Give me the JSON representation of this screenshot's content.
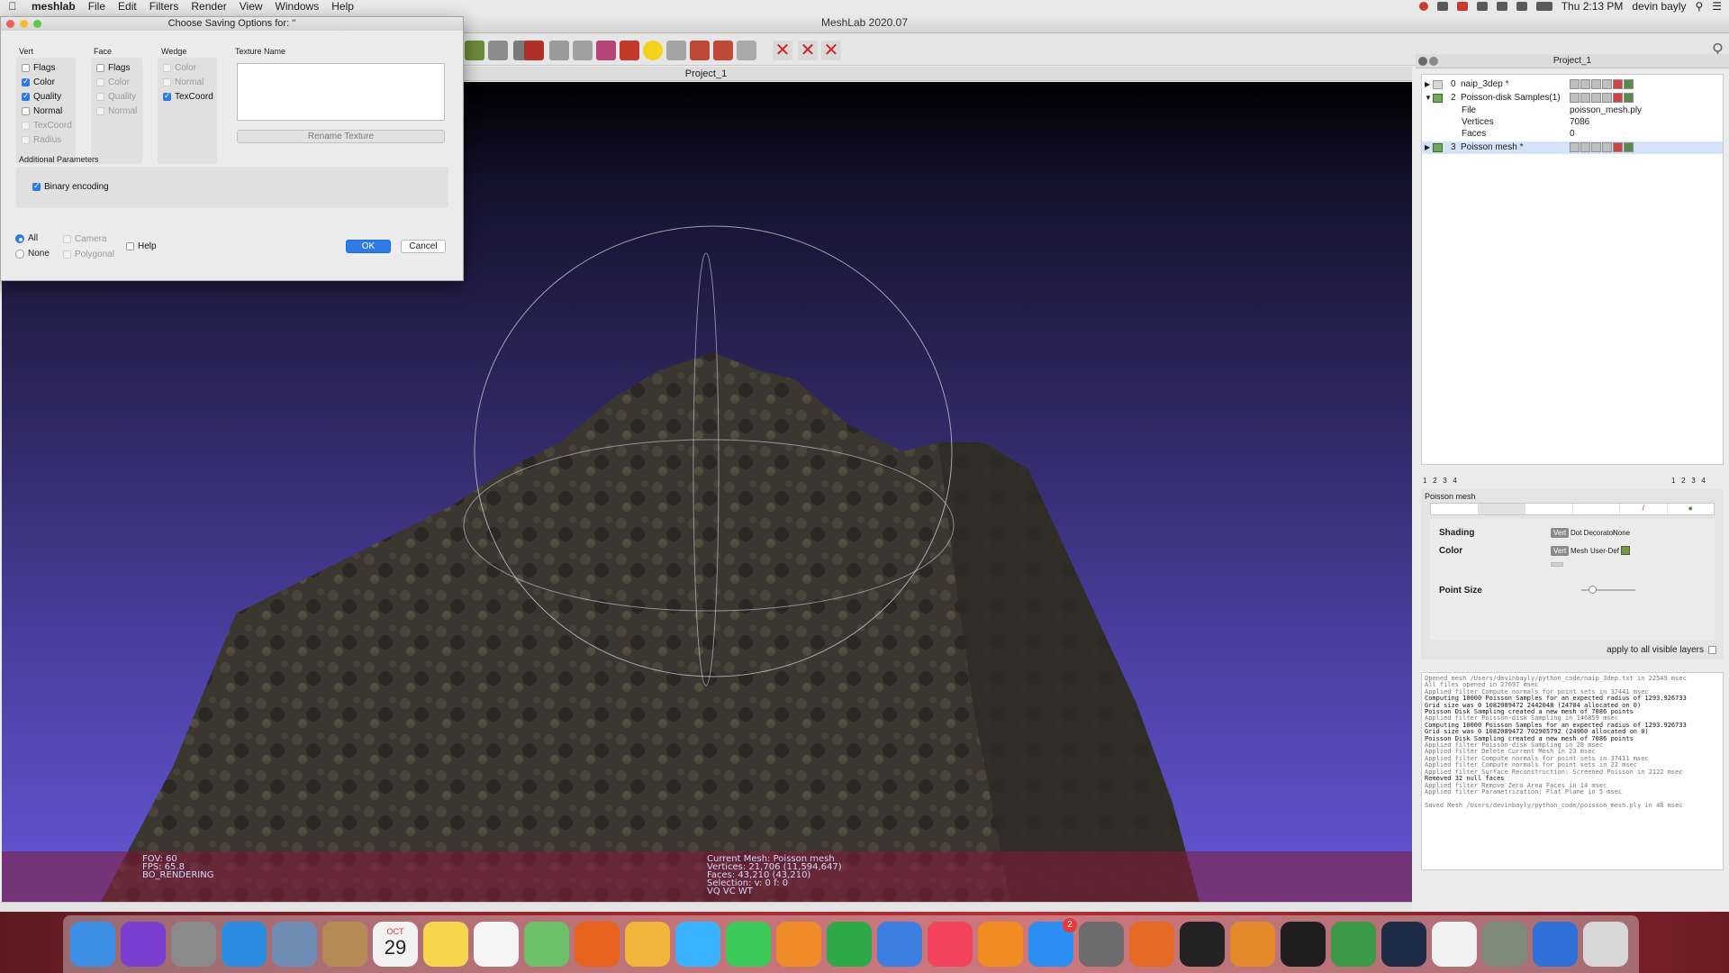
{
  "menubar": {
    "app_name": "meshlab",
    "menus": [
      "File",
      "Edit",
      "Filters",
      "Render",
      "View",
      "Windows",
      "Help"
    ],
    "clock": "Thu 2:13 PM",
    "user": "devin bayly"
  },
  "window": {
    "title": "MeshLab 2020.07",
    "viewport_tab": "Project_1"
  },
  "dialog": {
    "title": "Choose Saving Options for: ''",
    "groups": {
      "vert": {
        "label": "Vert",
        "items": [
          {
            "label": "Flags",
            "checked": false,
            "enabled": true
          },
          {
            "label": "Color",
            "checked": true,
            "enabled": true
          },
          {
            "label": "Quality",
            "checked": true,
            "enabled": true
          },
          {
            "label": "Normal",
            "checked": false,
            "enabled": true
          },
          {
            "label": "TexCoord",
            "checked": false,
            "enabled": false
          },
          {
            "label": "Radius",
            "checked": false,
            "enabled": false
          }
        ]
      },
      "face": {
        "label": "Face",
        "items": [
          {
            "label": "Flags",
            "checked": false,
            "enabled": true
          },
          {
            "label": "Color",
            "checked": false,
            "enabled": false
          },
          {
            "label": "Quality",
            "checked": false,
            "enabled": false
          },
          {
            "label": "Normal",
            "checked": false,
            "enabled": false
          }
        ]
      },
      "wedge": {
        "label": "Wedge",
        "items": [
          {
            "label": "Color",
            "checked": false,
            "enabled": false
          },
          {
            "label": "Normal",
            "checked": false,
            "enabled": false
          },
          {
            "label": "TexCoord",
            "checked": true,
            "enabled": true
          }
        ]
      }
    },
    "texture_name_label": "Texture Name",
    "rename_texture_label": "Rename Texture",
    "additional_params_label": "Additional Parameters",
    "binary_encoding_label": "Binary encoding",
    "binary_encoding_checked": true,
    "all_label": "All",
    "none_label": "None",
    "camera_label": "Camera",
    "polygonal_label": "Polygonal",
    "help_label": "Help",
    "ok_label": "OK",
    "cancel_label": "Cancel"
  },
  "hud": {
    "left": [
      "FOV: 60",
      "FPS:   65.8",
      "BO_RENDERING"
    ],
    "center": [
      "Current Mesh: Poisson mesh",
      "Vertices: 21,706    (11,594,647)",
      "Faces: 43,210    (43,210)",
      "Selection: v: 0 f: 0",
      "VQ VC WT"
    ]
  },
  "layers": {
    "header": "Project_1",
    "rows": [
      {
        "num": "0",
        "name": "naip_3dep *",
        "expanded": false,
        "selected": false
      },
      {
        "num": "2",
        "name": "Poisson-disk Samples(1)",
        "expanded": true,
        "selected": false
      },
      {
        "num": "3",
        "name": "Poisson mesh *",
        "expanded": false,
        "selected": true
      }
    ],
    "details": [
      {
        "key": "File",
        "value": "poisson_mesh.ply"
      },
      {
        "key": "Vertices",
        "value": "7086"
      },
      {
        "key": "Faces",
        "value": "0"
      }
    ],
    "pager_left": [
      "1",
      "2",
      "3",
      "4"
    ],
    "pager_right": [
      "1",
      "2",
      "3",
      "4"
    ]
  },
  "props": {
    "title": "Poisson mesh",
    "shading_label": "Shading",
    "shading_options": [
      "Vert",
      "Dot Decorator",
      "None"
    ],
    "color_label": "Color",
    "color_options": [
      "Vert",
      "Mesh",
      "User-Def"
    ],
    "point_size_label": "Point Size",
    "apply_all_label": "apply to all visible layers",
    "user_color": "#6a9a3a",
    "point_size_level": 0.15
  },
  "log": [
    {
      "t": "Opened mesh /Users/devinbayly/python_code/naip_3dep.txt in 22549 msec",
      "b": false
    },
    {
      "t": "All files opened in 27697 msec",
      "b": false
    },
    {
      "t": "Applied filter Compute normals for point sets in 37441 msec",
      "b": false
    },
    {
      "t": "Computing 10000 Poisson Samples for an expected radius of 1293.926733",
      "b": true
    },
    {
      "t": "Grid size was 0 1082089472 2442048 (24704 allocated on 0)",
      "b": true
    },
    {
      "t": "Poisson Disk Sampling created a new mesh of 7086 points",
      "b": true
    },
    {
      "t": "Applied filter Poisson-disk Sampling in 146859 msec",
      "b": false
    },
    {
      "t": "Computing 10000 Poisson Samples for an expected radius of 1293.926733",
      "b": true
    },
    {
      "t": "Grid size was 0 1082089472 702905792 (24960 allocated on 0)",
      "b": true
    },
    {
      "t": "Poisson Disk Sampling created a new mesh of 7086 points",
      "b": true
    },
    {
      "t": "Applied filter Poisson-disk Sampling in 28 msec",
      "b": false
    },
    {
      "t": "Applied filter Delete Current Mesh in 23 msec",
      "b": false
    },
    {
      "t": "Applied filter Compute normals for point sets in 37411 msec",
      "b": false
    },
    {
      "t": "Applied filter Compute normals for point sets in 22 msec",
      "b": false
    },
    {
      "t": "Applied filter Surface Reconstruction: Screened Poisson in 2122 msec",
      "b": false
    },
    {
      "t": "Removed 32 null faces",
      "b": true
    },
    {
      "t": "Applied filter Remove Zero Area Faces in 14 msec",
      "b": false
    },
    {
      "t": "Applied filter Parametrization: Flat Plane in 5 msec",
      "b": false
    },
    {
      "t": "",
      "b": false
    },
    {
      "t": "Saved Mesh /Users/devinbayly/python_code/poisson_mesh.ply in 48 msec",
      "b": false
    }
  ],
  "dock": [
    {
      "name": "finder-icon",
      "color": "#3d8fe6"
    },
    {
      "name": "siri-icon",
      "color": "#7a3fd0"
    },
    {
      "name": "launchpad-icon",
      "color": "#8a8a8a"
    },
    {
      "name": "safari-icon",
      "color": "#2a8de0"
    },
    {
      "name": "preview-icon",
      "color": "#6f8db4"
    },
    {
      "name": "contacts-icon",
      "color": "#b68a55"
    },
    {
      "name": "calendar-icon",
      "color": "#f2f2f2",
      "text": "29",
      "sub": "OCT"
    },
    {
      "name": "notes-icon",
      "color": "#f6d64a"
    },
    {
      "name": "reminders-icon",
      "color": "#f5f5f5"
    },
    {
      "name": "maps-icon",
      "color": "#6cc06a"
    },
    {
      "name": "eye-app-icon",
      "color": "#e9631f"
    },
    {
      "name": "photos-icon",
      "color": "#f1b53a"
    },
    {
      "name": "messages-icon",
      "color": "#39b3ff"
    },
    {
      "name": "facetime-icon",
      "color": "#3cc957"
    },
    {
      "name": "pages-icon",
      "color": "#f08b2a"
    },
    {
      "name": "numbers-icon",
      "color": "#2fa84a"
    },
    {
      "name": "keynote-icon",
      "color": "#3b7ee0"
    },
    {
      "name": "music-icon",
      "color": "#f2425c"
    },
    {
      "name": "books-icon",
      "color": "#f28b21"
    },
    {
      "name": "app-store-icon",
      "color": "#2b8ef0",
      "badge": "2"
    },
    {
      "name": "system-preferences-icon",
      "color": "#6c6c6c"
    },
    {
      "name": "firefox-icon",
      "color": "#e66a24"
    },
    {
      "name": "activity-monitor-icon",
      "color": "#232323"
    },
    {
      "name": "blender-icon",
      "color": "#e58a2a"
    },
    {
      "name": "terminal-icon",
      "color": "#1e1e1e"
    },
    {
      "name": "chrome-icon",
      "color": "#3c9a46"
    },
    {
      "name": "steam-icon",
      "color": "#1b2b48"
    },
    {
      "name": "textedit-icon",
      "color": "#f1f1f1"
    },
    {
      "name": "eye-icon",
      "color": "#7d8a78"
    },
    {
      "name": "quicktime-icon",
      "color": "#2e6fd8"
    },
    {
      "name": "trash-icon",
      "color": "#d7d7d7"
    }
  ]
}
